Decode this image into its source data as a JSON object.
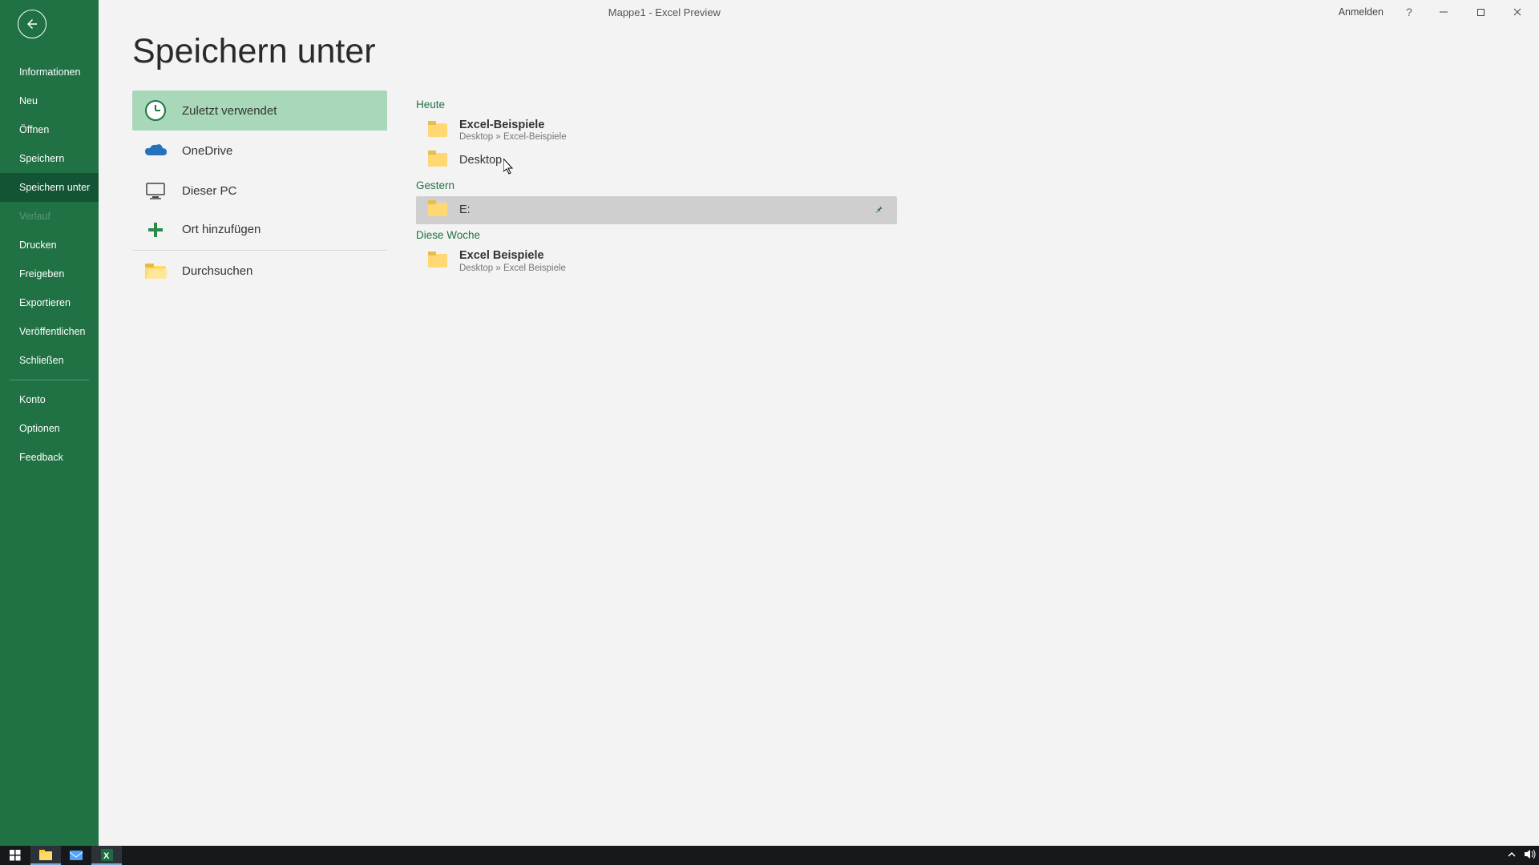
{
  "window": {
    "title": "Mappe1  -  Excel Preview",
    "signin": "Anmelden"
  },
  "nav": {
    "items": [
      {
        "key": "info",
        "label": "Informationen"
      },
      {
        "key": "new",
        "label": "Neu"
      },
      {
        "key": "open",
        "label": "Öffnen"
      },
      {
        "key": "save",
        "label": "Speichern"
      },
      {
        "key": "saveas",
        "label": "Speichern unter",
        "active": true
      },
      {
        "key": "history",
        "label": "Verlauf",
        "disabled": true
      },
      {
        "key": "print",
        "label": "Drucken"
      },
      {
        "key": "share",
        "label": "Freigeben"
      },
      {
        "key": "export",
        "label": "Exportieren"
      },
      {
        "key": "publish",
        "label": "Veröffentlichen"
      },
      {
        "key": "close",
        "label": "Schließen"
      }
    ],
    "footer": [
      {
        "key": "account",
        "label": "Konto"
      },
      {
        "key": "options",
        "label": "Optionen"
      },
      {
        "key": "feedback",
        "label": "Feedback"
      }
    ]
  },
  "page": {
    "title": "Speichern unter"
  },
  "locations": [
    {
      "key": "recent",
      "label": "Zuletzt verwendet",
      "active": true
    },
    {
      "key": "onedrive",
      "label": "OneDrive"
    },
    {
      "key": "thispc",
      "label": "Dieser PC"
    },
    {
      "key": "addplace",
      "label": "Ort hinzufügen",
      "divider_below": true
    },
    {
      "key": "browse",
      "label": "Durchsuchen"
    }
  ],
  "recent_groups": [
    {
      "label": "Heute",
      "items": [
        {
          "name": "Excel-Beispiele",
          "path": "Desktop » Excel-Beispiele",
          "bold": true
        },
        {
          "name": "Desktop"
        }
      ]
    },
    {
      "label": "Gestern",
      "items": [
        {
          "name": "E:",
          "hovered": true
        }
      ]
    },
    {
      "label": "Diese Woche",
      "items": [
        {
          "name": "Excel Beispiele",
          "path": "Desktop » Excel Beispiele",
          "bold": true
        }
      ]
    }
  ]
}
